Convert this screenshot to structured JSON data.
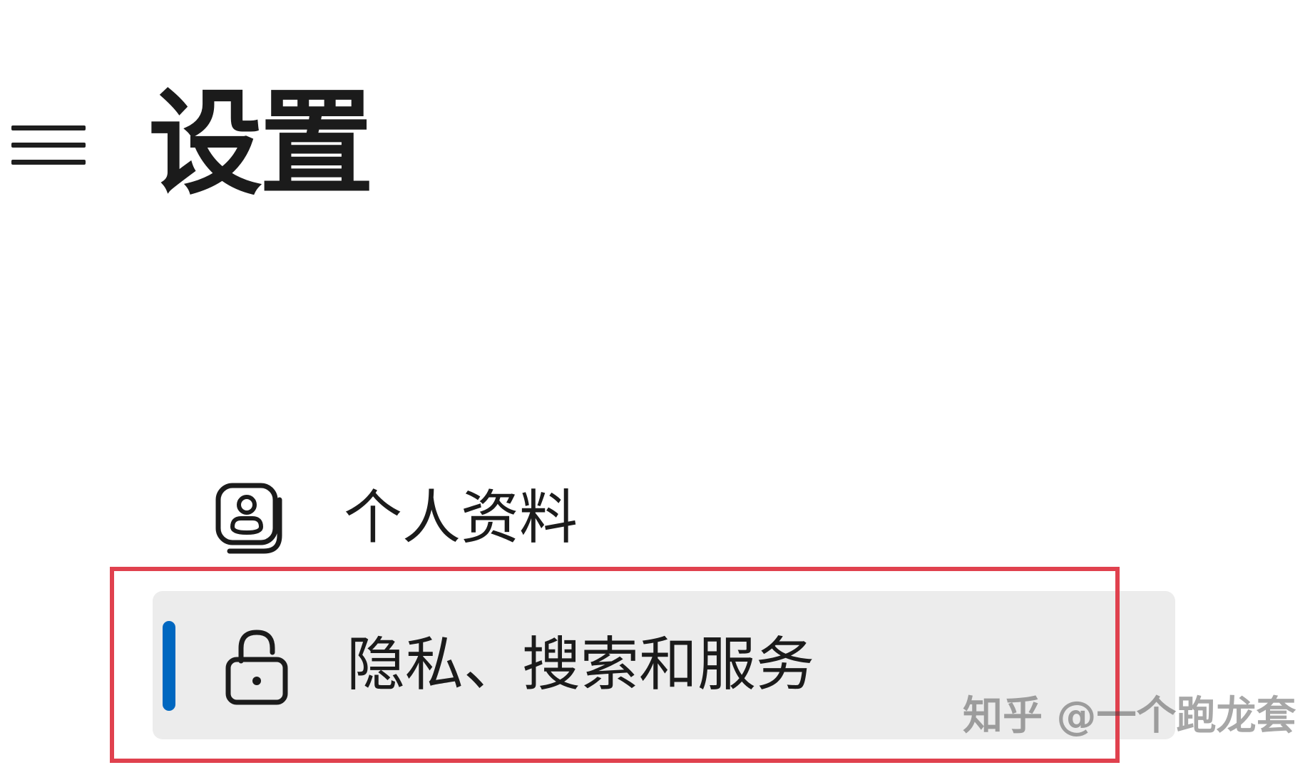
{
  "header": {
    "menu_icon": "hamburger-menu-icon",
    "title": "设置"
  },
  "sidebar": {
    "items": [
      {
        "label": "个人资料",
        "icon": "profile-badge-icon",
        "selected": false
      },
      {
        "label": "隐私、搜索和服务",
        "icon": "lock-icon",
        "selected": true
      }
    ]
  },
  "annotation": {
    "highlight_color": "#e0414e"
  },
  "watermark": {
    "text": "知乎 @一个跑龙套"
  },
  "colors": {
    "accent": "#0067c0",
    "selected_background": "#ececec"
  }
}
